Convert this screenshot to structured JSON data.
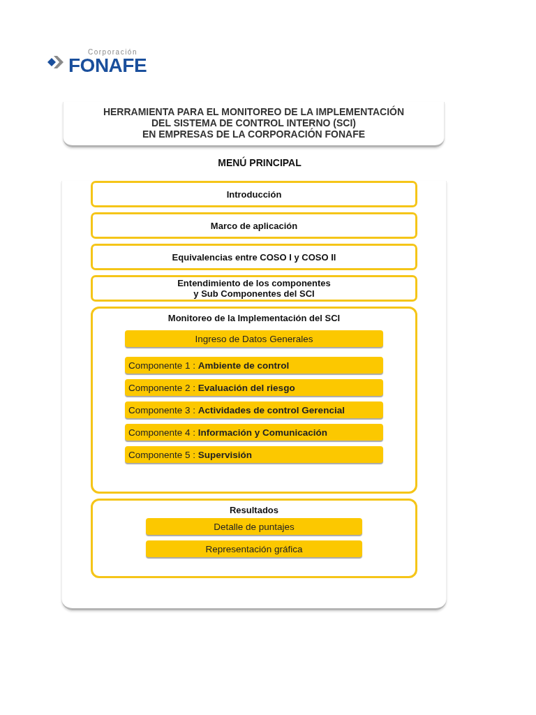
{
  "logo": {
    "small": "Corporación",
    "big": "FONAFE"
  },
  "header": {
    "lines": [
      "HERRAMIENTA PARA EL MONITOREO DE LA IMPLEMENTACIÓN",
      "DEL SISTEMA DE CONTROL INTERNO (SCI)",
      "EN EMPRESAS DE LA CORPORACIÓN FONAFE"
    ]
  },
  "menu_title": "MENÚ PRINCIPAL",
  "menu_items": [
    {
      "label": "Introducción"
    },
    {
      "label": "Marco de aplicación"
    },
    {
      "label": "Equivalencias entre COSO I y COSO II"
    },
    {
      "label": "Entendimiento de los componentes\ny  Sub Componentes del SCI"
    }
  ],
  "monitoring": {
    "title": "Monitoreo de la Implementación del SCI",
    "general": "Ingreso de Datos Generales",
    "components": [
      "Componente 1 : **Ambiente de control**",
      "Componente 2 : **Evaluación del riesgo**",
      "Componente 3 : **Actividades de control Gerencial**",
      "Componente 4 : **Información y Comunicación**",
      "Componente 5 : **Supervisión**"
    ]
  },
  "results": {
    "title": "Resultados",
    "buttons": [
      "Detalle de puntajes",
      "Representación gráfica"
    ]
  }
}
